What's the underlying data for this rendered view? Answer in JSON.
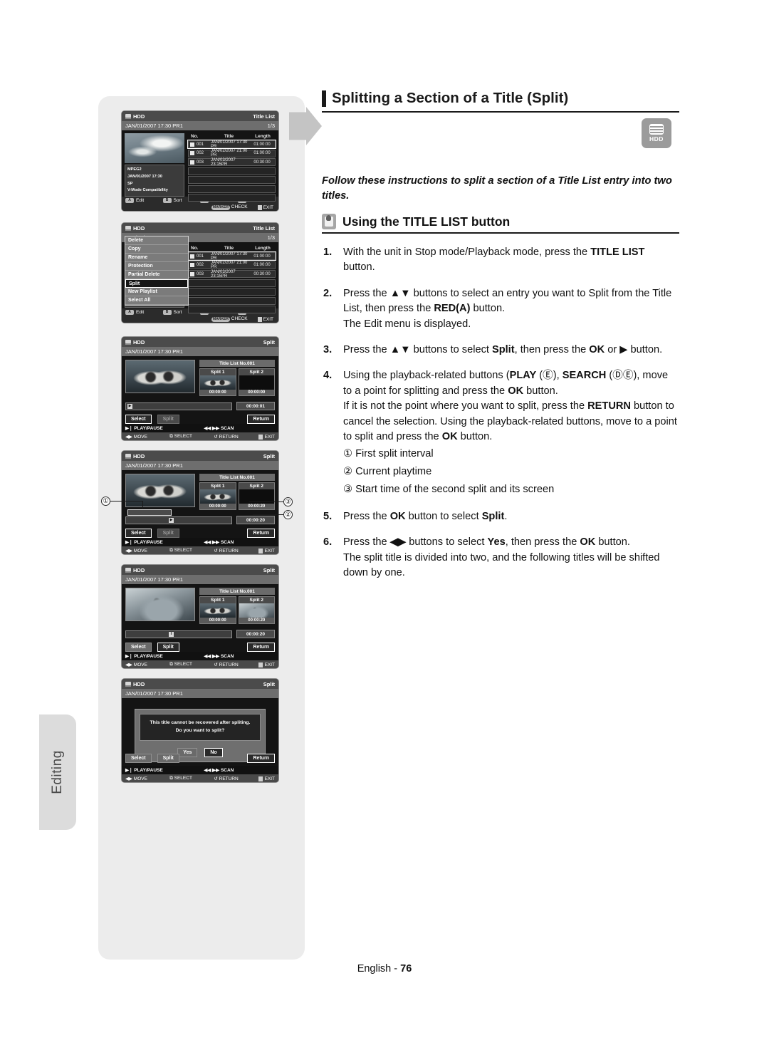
{
  "document": {
    "chapter_title": "Splitting a Section of a Title (Split)",
    "media_badge": "HDD",
    "intro": "Follow these instructions to split a section of a Title List entry into two titles.",
    "subhead": "Using the TITLE LIST button",
    "side_tab": "Editing",
    "footer_lang": "English",
    "footer_sep": "-",
    "footer_page": "76"
  },
  "steps": [
    {
      "num": "1.",
      "lines": [
        [
          {
            "t": "With the unit in Stop mode/Playback mode, press the "
          },
          {
            "t": "TITLE LIST",
            "b": true
          },
          {
            "t": " button."
          }
        ]
      ]
    },
    {
      "num": "2.",
      "lines": [
        [
          {
            "t": "Press the "
          },
          {
            "t": "▲▼",
            "b": true
          },
          {
            "t": " buttons to select an entry you want to Split from the Title List, then press the "
          },
          {
            "t": "RED(A)",
            "b": true
          },
          {
            "t": " button."
          }
        ],
        [
          {
            "t": "The Edit menu is displayed."
          }
        ]
      ]
    },
    {
      "num": "3.",
      "lines": [
        [
          {
            "t": "Press the "
          },
          {
            "t": "▲▼",
            "b": true
          },
          {
            "t": " buttons to select "
          },
          {
            "t": "Split",
            "b": true
          },
          {
            "t": ", then press the "
          },
          {
            "t": "OK",
            "b": true
          },
          {
            "t": " or ▶ button."
          }
        ]
      ]
    },
    {
      "num": "4.",
      "lines": [
        [
          {
            "t": "Using the playback-related buttons ("
          },
          {
            "t": "PLAY",
            "b": true
          },
          {
            "t": " (Ⓔ), "
          },
          {
            "t": "SEARCH",
            "b": true
          },
          {
            "t": " (ⒹⒺ), move to a point for splitting and press the "
          },
          {
            "t": "OK",
            "b": true
          },
          {
            "t": " button."
          }
        ],
        [
          {
            "t": "If it is not the point where you want to split, press the "
          },
          {
            "t": "RETURN",
            "b": true
          },
          {
            "t": " button to cancel the selection. Using the playback-related buttons, move to a point to split and press the "
          },
          {
            "t": "OK",
            "b": true
          },
          {
            "t": " button."
          }
        ]
      ],
      "sub_items": [
        "① First split interval",
        "② Current playtime",
        "③ Start time of the second split and its screen"
      ]
    },
    {
      "num": "5.",
      "lines": [
        [
          {
            "t": "Press the "
          },
          {
            "t": "OK",
            "b": true
          },
          {
            "t": " button to select "
          },
          {
            "t": "Split",
            "b": true
          },
          {
            "t": "."
          }
        ]
      ]
    },
    {
      "num": "6.",
      "lines": [
        [
          {
            "t": "Press the "
          },
          {
            "t": "◀▶",
            "b": true
          },
          {
            "t": " buttons to select "
          },
          {
            "t": "Yes",
            "b": true
          },
          {
            "t": ", then press the "
          },
          {
            "t": "OK",
            "b": true
          },
          {
            "t": " button."
          }
        ],
        [
          {
            "t": "The split title is divided into two, and the following titles will be shifted down by one."
          }
        ]
      ]
    }
  ],
  "screens": {
    "common": {
      "source": "HDD",
      "status_date": "JAN/01/2007 17:30 PR1",
      "page_indicator": "1/3",
      "title_list_label": "Title List",
      "split_label": "Split"
    },
    "titlelist": {
      "columns": [
        "No.",
        "Title",
        "Length"
      ],
      "rows": [
        {
          "no": "001",
          "title": "JAN/01/2007 17:30 PR",
          "length": "01:00:00",
          "selected": true
        },
        {
          "no": "002",
          "title": "JAN/02/2007 21:00 PR",
          "length": "01:00:00",
          "selected": false
        },
        {
          "no": "003",
          "title": "JAN/03/2007 23:15PR",
          "length": "00:30:00",
          "selected": false
        }
      ],
      "info": [
        "MPEG2",
        "JAN/01/2007 17:30",
        "SP",
        "V-Mode Compatibility"
      ],
      "buttons": [
        {
          "key": "A",
          "label": "Edit"
        },
        {
          "key": "B",
          "label": "Sort"
        },
        {
          "key": "C",
          "label": "Go to"
        },
        {
          "key": "D",
          "label": "Contents"
        }
      ],
      "marker_key": "MARKER",
      "marker_label": "CHECK",
      "exit_label": "EXIT"
    },
    "edit_menu": {
      "items": [
        {
          "label": "Delete",
          "selected": false
        },
        {
          "label": "Copy",
          "selected": false
        },
        {
          "label": "Rename",
          "selected": false
        },
        {
          "label": "Protection",
          "selected": false
        },
        {
          "label": "Partial Delete",
          "selected": false
        },
        {
          "label": "Split",
          "selected": true
        },
        {
          "label": "New Playlist",
          "selected": false
        },
        {
          "label": "Select All",
          "selected": false
        }
      ]
    },
    "split_common": {
      "title_no": "Title List No.001",
      "split1_label": "Split 1",
      "split2_label": "Split 2",
      "select_btn": "Select",
      "split_btn": "Split",
      "return_btn": "Return",
      "play_pause": "PLAY/PAUSE",
      "scan": "SCAN",
      "move": "MOVE",
      "select_hint": "SELECT",
      "return_hint": "RETURN",
      "exit_hint": "EXIT"
    },
    "split_a": {
      "split1_time": "00:00:00",
      "split2_time": "00:00:00",
      "current_time": "00:00:01",
      "active_button": "Select"
    },
    "split_b": {
      "split1_time": "00:00:00",
      "split2_time": "00:00:20",
      "current_time": "00:00:20",
      "active_button": "Select"
    },
    "split_c": {
      "split1_time": "00:00:00",
      "split2_time": "00:00:20",
      "current_time": "00:00:20",
      "active_button": "Split"
    },
    "confirm": {
      "line1": "This title cannot be recovered after spliting.",
      "line2": "Do you want to split?",
      "yes": "Yes",
      "no": "No",
      "selected": "No"
    },
    "callouts": [
      {
        "id": "1",
        "glyph": "①"
      },
      {
        "id": "2",
        "glyph": "②"
      },
      {
        "id": "3",
        "glyph": "③"
      }
    ]
  }
}
